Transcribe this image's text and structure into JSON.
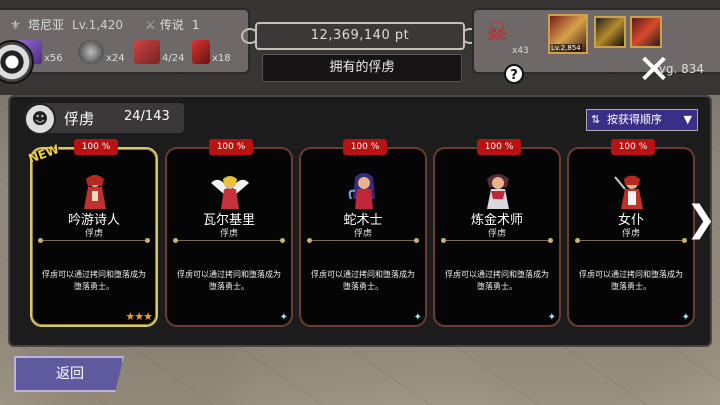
{
  "header": {
    "player_name": "塔尼亚",
    "player_level": "Lv.1,420",
    "legend_label": "传说",
    "legend_count": "1",
    "inventory": [
      {
        "icon": "gem-box-icon",
        "count": "x56"
      },
      {
        "icon": "orb-icon",
        "count": "x24"
      },
      {
        "icon": "book-icon",
        "count": "4/24"
      },
      {
        "icon": "card-icon",
        "count": "x18"
      }
    ],
    "points": "12,369,140 pt",
    "title": "拥有的俘虏",
    "demon_count": "x43",
    "party_portraits": [
      {
        "level": "Lv.2,854"
      },
      {
        "level": ""
      },
      {
        "level": ""
      }
    ],
    "average": "Avg. 834",
    "help_label": "?",
    "close_label": "✕"
  },
  "section": {
    "label": "俘虏",
    "count": "24/143",
    "sort_label": "按获得顺序",
    "sort_arrow": "▼"
  },
  "cards": [
    {
      "pct": "100 %",
      "name": "吟游诗人",
      "type": "俘虏",
      "desc": "俘虏可以通过拷问和堕落成为堕落勇士。",
      "badge": "★★★",
      "new": "NEW",
      "accent": "#d9c86a"
    },
    {
      "pct": "100 %",
      "name": "瓦尔基里",
      "type": "俘虏",
      "desc": "俘虏可以通过拷问和堕落成为堕落勇士。",
      "badge": "✦"
    },
    {
      "pct": "100 %",
      "name": "蛇术士",
      "type": "俘虏",
      "desc": "俘虏可以通过拷问和堕落成为堕落勇士。",
      "badge": "✦"
    },
    {
      "pct": "100 %",
      "name": "炼金术师",
      "type": "俘虏",
      "desc": "俘虏可以通过拷问和堕落成为堕落勇士。",
      "badge": "✦"
    },
    {
      "pct": "100 %",
      "name": "女仆",
      "type": "俘虏",
      "desc": "俘虏可以通过拷问和堕落成为堕落勇士。",
      "badge": "✦"
    }
  ],
  "footer": {
    "back_label": "返回"
  },
  "colors": {
    "percent_badge": "#b91212",
    "sort_bg": "#3a2f86",
    "back_bg": "#5f5a9e"
  }
}
